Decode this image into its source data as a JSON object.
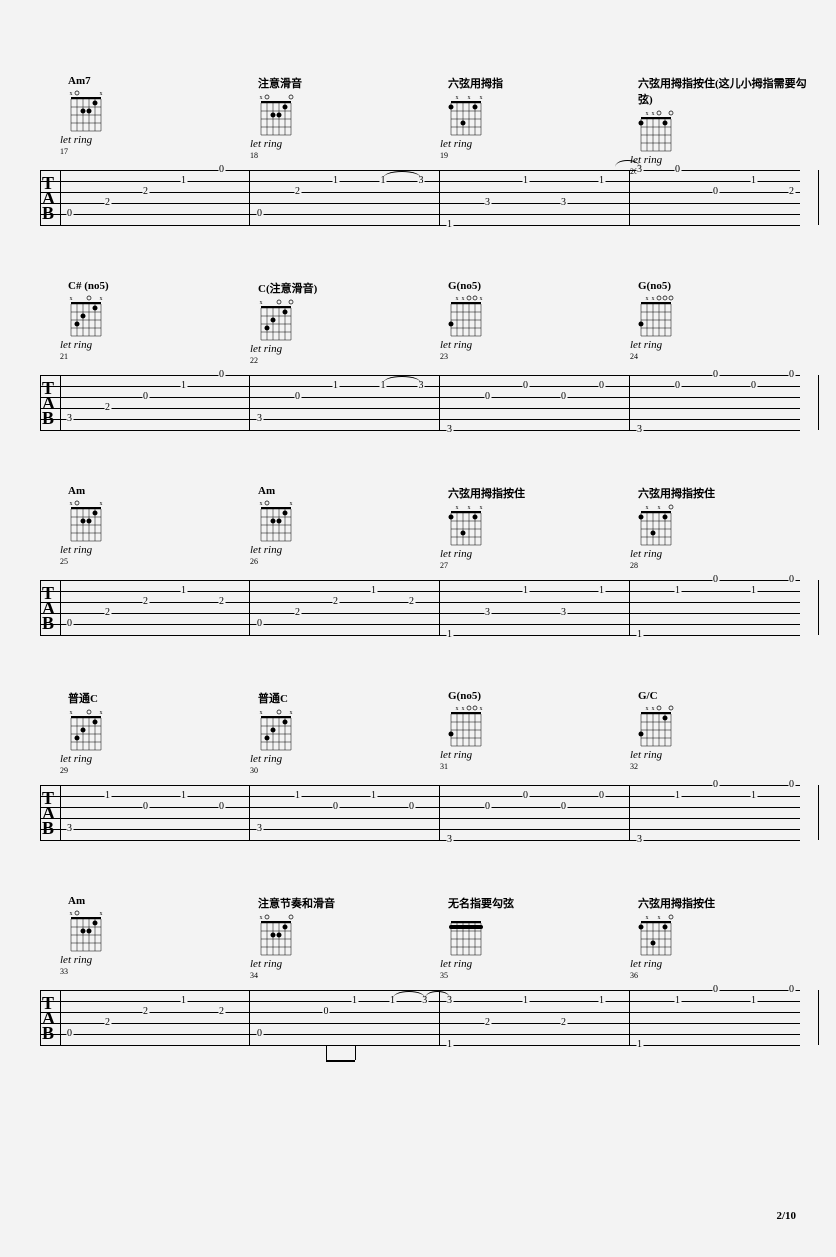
{
  "page_number": "2/10",
  "systems": [
    {
      "measures": [
        {
          "num": "17",
          "chord": "Am7",
          "letring": "let ring",
          "notes": [
            {
              "s": 5,
              "f": "0",
              "p": 5
            },
            {
              "s": 4,
              "f": "2",
              "p": 25
            },
            {
              "s": 3,
              "f": "2",
              "p": 45
            },
            {
              "s": 2,
              "f": "1",
              "p": 65
            },
            {
              "s": 1,
              "f": "0",
              "p": 85
            }
          ],
          "dots": [
            {
              "s": 2,
              "f": 1
            },
            {
              "s": 3,
              "f": 2
            },
            {
              "s": 4,
              "f": 2
            }
          ],
          "muted": [
            1,
            6
          ],
          "open": [
            5
          ]
        },
        {
          "num": "18",
          "chord": "注意滑音",
          "letring": "let ring",
          "notes": [
            {
              "s": 5,
              "f": "0",
              "p": 5
            },
            {
              "s": 3,
              "f": "2",
              "p": 25
            },
            {
              "s": 2,
              "f": "1",
              "p": 45
            },
            {
              "s": 2,
              "f": "1",
              "p": 70
            },
            {
              "s": 2,
              "f": "3",
              "p": 90,
              "tie_from": 70
            }
          ],
          "dots": [
            {
              "s": 2,
              "f": 1
            },
            {
              "s": 3,
              "f": 2
            },
            {
              "s": 4,
              "f": 2
            }
          ],
          "muted": [
            6
          ],
          "open": [
            1,
            5
          ]
        },
        {
          "num": "19",
          "chord": "六弦用拇指",
          "letring": "let ring",
          "notes": [
            {
              "s": 6,
              "f": "1",
              "p": 5
            },
            {
              "s": 4,
              "f": "3",
              "p": 25
            },
            {
              "s": 2,
              "f": "1",
              "p": 45
            },
            {
              "s": 4,
              "f": "3",
              "p": 65
            },
            {
              "s": 2,
              "f": "1",
              "p": 85
            }
          ],
          "dots": [
            {
              "s": 2,
              "f": 1
            },
            {
              "s": 4,
              "f": 3
            },
            {
              "s": 6,
              "f": 1
            }
          ],
          "muted": [
            1,
            3,
            5
          ]
        },
        {
          "num": "20",
          "chord": "六弦用拇指按住(这儿小拇指需要勾弦)",
          "letring": "let ring",
          "notes": [
            {
              "s": 1,
              "f": "3",
              "p": 5,
              "tie_to": true
            },
            {
              "s": 1,
              "f": "0",
              "p": 25
            },
            {
              "s": 3,
              "f": "0",
              "p": 45
            },
            {
              "s": 2,
              "f": "1",
              "p": 65
            },
            {
              "s": 3,
              "f": "2",
              "p": 85
            }
          ],
          "dots": [
            {
              "s": 2,
              "f": 1
            },
            {
              "s": 6,
              "f": 1
            }
          ],
          "muted": [
            4,
            5
          ],
          "open": [
            1,
            3
          ]
        }
      ]
    },
    {
      "measures": [
        {
          "num": "21",
          "chord": "C# (no5)",
          "letring": "let ring",
          "notes": [
            {
              "s": 5,
              "f": "3",
              "p": 5
            },
            {
              "s": 4,
              "f": "2",
              "p": 25
            },
            {
              "s": 3,
              "f": "0",
              "p": 45
            },
            {
              "s": 2,
              "f": "1",
              "p": 65
            },
            {
              "s": 1,
              "f": "0",
              "p": 85
            }
          ],
          "dots": [
            {
              "s": 2,
              "f": 1
            },
            {
              "s": 4,
              "f": 2
            },
            {
              "s": 5,
              "f": 3
            }
          ],
          "muted": [
            1,
            6
          ],
          "open": [
            3
          ]
        },
        {
          "num": "22",
          "chord": "C(注意滑音)",
          "letring": "let ring",
          "notes": [
            {
              "s": 5,
              "f": "3",
              "p": 5
            },
            {
              "s": 3,
              "f": "0",
              "p": 25
            },
            {
              "s": 2,
              "f": "1",
              "p": 45
            },
            {
              "s": 2,
              "f": "1",
              "p": 70
            },
            {
              "s": 2,
              "f": "3",
              "p": 90,
              "tie_from": 70
            }
          ],
          "dots": [
            {
              "s": 2,
              "f": 1
            },
            {
              "s": 4,
              "f": 2
            },
            {
              "s": 5,
              "f": 3
            }
          ],
          "muted": [
            6
          ],
          "open": [
            1,
            3
          ]
        },
        {
          "num": "23",
          "chord": "G(no5)",
          "letring": "let ring",
          "notes": [
            {
              "s": 6,
              "f": "3",
              "p": 5
            },
            {
              "s": 3,
              "f": "0",
              "p": 25
            },
            {
              "s": 2,
              "f": "0",
              "p": 45
            },
            {
              "s": 3,
              "f": "0",
              "p": 65
            },
            {
              "s": 2,
              "f": "0",
              "p": 85
            }
          ],
          "dots": [
            {
              "s": 6,
              "f": 3
            }
          ],
          "muted": [
            1,
            4,
            5
          ],
          "open": [
            2,
            3
          ]
        },
        {
          "num": "24",
          "chord": "G(no5)",
          "letring": "let ring",
          "notes": [
            {
              "s": 6,
              "f": "3",
              "p": 5
            },
            {
              "s": 2,
              "f": "0",
              "p": 25
            },
            {
              "s": 1,
              "f": "0",
              "p": 45
            },
            {
              "s": 2,
              "f": "0",
              "p": 65
            },
            {
              "s": 1,
              "f": "0",
              "p": 85
            }
          ],
          "dots": [
            {
              "s": 6,
              "f": 3
            }
          ],
          "muted": [
            4,
            5
          ],
          "open": [
            1,
            2,
            3
          ]
        }
      ]
    },
    {
      "measures": [
        {
          "num": "25",
          "chord": "Am",
          "letring": "let ring",
          "notes": [
            {
              "s": 5,
              "f": "0",
              "p": 5
            },
            {
              "s": 4,
              "f": "2",
              "p": 25
            },
            {
              "s": 3,
              "f": "2",
              "p": 45
            },
            {
              "s": 2,
              "f": "1",
              "p": 65
            },
            {
              "s": 3,
              "f": "2",
              "p": 85
            }
          ],
          "dots": [
            {
              "s": 2,
              "f": 1
            },
            {
              "s": 3,
              "f": 2
            },
            {
              "s": 4,
              "f": 2
            }
          ],
          "muted": [
            1,
            6
          ],
          "open": [
            5
          ]
        },
        {
          "num": "26",
          "chord": "Am",
          "letring": "let ring",
          "notes": [
            {
              "s": 5,
              "f": "0",
              "p": 5
            },
            {
              "s": 4,
              "f": "2",
              "p": 25
            },
            {
              "s": 3,
              "f": "2",
              "p": 45
            },
            {
              "s": 2,
              "f": "1",
              "p": 65
            },
            {
              "s": 3,
              "f": "2",
              "p": 85
            }
          ],
          "dots": [
            {
              "s": 2,
              "f": 1
            },
            {
              "s": 3,
              "f": 2
            },
            {
              "s": 4,
              "f": 2
            }
          ],
          "muted": [
            1,
            6
          ],
          "open": [
            5
          ]
        },
        {
          "num": "27",
          "chord": "六弦用拇指按住",
          "letring": "let ring",
          "notes": [
            {
              "s": 6,
              "f": "1",
              "p": 5
            },
            {
              "s": 4,
              "f": "3",
              "p": 25
            },
            {
              "s": 2,
              "f": "1",
              "p": 45
            },
            {
              "s": 4,
              "f": "3",
              "p": 65
            },
            {
              "s": 2,
              "f": "1",
              "p": 85
            }
          ],
          "dots": [
            {
              "s": 2,
              "f": 1
            },
            {
              "s": 4,
              "f": 3
            },
            {
              "s": 6,
              "f": 1
            }
          ],
          "muted": [
            1,
            3,
            5
          ]
        },
        {
          "num": "28",
          "chord": "六弦用拇指按住",
          "letring": "let ring",
          "notes": [
            {
              "s": 6,
              "f": "1",
              "p": 5
            },
            {
              "s": 2,
              "f": "1",
              "p": 25
            },
            {
              "s": 1,
              "f": "0",
              "p": 45
            },
            {
              "s": 2,
              "f": "1",
              "p": 65
            },
            {
              "s": 1,
              "f": "0",
              "p": 85
            }
          ],
          "dots": [
            {
              "s": 2,
              "f": 1
            },
            {
              "s": 4,
              "f": 3
            },
            {
              "s": 6,
              "f": 1
            }
          ],
          "muted": [
            3,
            5
          ],
          "open": [
            1
          ]
        }
      ]
    },
    {
      "measures": [
        {
          "num": "29",
          "chord": "普通C",
          "letring": "let ring",
          "notes": [
            {
              "s": 5,
              "f": "3",
              "p": 5
            },
            {
              "s": 2,
              "f": "1",
              "p": 25
            },
            {
              "s": 3,
              "f": "0",
              "p": 45
            },
            {
              "s": 2,
              "f": "1",
              "p": 65
            },
            {
              "s": 3,
              "f": "0",
              "p": 85
            }
          ],
          "dots": [
            {
              "s": 2,
              "f": 1
            },
            {
              "s": 4,
              "f": 2
            },
            {
              "s": 5,
              "f": 3
            }
          ],
          "muted": [
            1,
            6
          ],
          "open": [
            3
          ]
        },
        {
          "num": "30",
          "chord": "普通C",
          "letring": "let ring",
          "notes": [
            {
              "s": 5,
              "f": "3",
              "p": 5
            },
            {
              "s": 2,
              "f": "1",
              "p": 25
            },
            {
              "s": 3,
              "f": "0",
              "p": 45
            },
            {
              "s": 2,
              "f": "1",
              "p": 65
            },
            {
              "s": 3,
              "f": "0",
              "p": 85
            }
          ],
          "dots": [
            {
              "s": 2,
              "f": 1
            },
            {
              "s": 4,
              "f": 2
            },
            {
              "s": 5,
              "f": 3
            }
          ],
          "muted": [
            1,
            6
          ],
          "open": [
            3
          ]
        },
        {
          "num": "31",
          "chord": "G(no5)",
          "letring": "let ring",
          "notes": [
            {
              "s": 6,
              "f": "3",
              "p": 5
            },
            {
              "s": 3,
              "f": "0",
              "p": 25
            },
            {
              "s": 2,
              "f": "0",
              "p": 45
            },
            {
              "s": 3,
              "f": "0",
              "p": 65
            },
            {
              "s": 2,
              "f": "0",
              "p": 85
            }
          ],
          "dots": [
            {
              "s": 6,
              "f": 3
            }
          ],
          "muted": [
            1,
            4,
            5
          ],
          "open": [
            2,
            3
          ]
        },
        {
          "num": "32",
          "chord": "G/C",
          "letring": "let ring",
          "notes": [
            {
              "s": 6,
              "f": "3",
              "p": 5
            },
            {
              "s": 2,
              "f": "1",
              "p": 25
            },
            {
              "s": 1,
              "f": "0",
              "p": 45
            },
            {
              "s": 2,
              "f": "1",
              "p": 65
            },
            {
              "s": 1,
              "f": "0",
              "p": 85
            }
          ],
          "dots": [
            {
              "s": 2,
              "f": 1
            },
            {
              "s": 6,
              "f": 3
            }
          ],
          "muted": [
            4,
            5
          ],
          "open": [
            1,
            3
          ]
        }
      ]
    },
    {
      "measures": [
        {
          "num": "33",
          "chord": "Am",
          "letring": "let ring",
          "notes": [
            {
              "s": 5,
              "f": "0",
              "p": 5
            },
            {
              "s": 4,
              "f": "2",
              "p": 25
            },
            {
              "s": 3,
              "f": "2",
              "p": 45
            },
            {
              "s": 2,
              "f": "1",
              "p": 65
            },
            {
              "s": 3,
              "f": "2",
              "p": 85
            }
          ],
          "dots": [
            {
              "s": 2,
              "f": 1
            },
            {
              "s": 3,
              "f": 2
            },
            {
              "s": 4,
              "f": 2
            }
          ],
          "muted": [
            1,
            6
          ],
          "open": [
            5
          ]
        },
        {
          "num": "34",
          "chord": "注意节奏和滑音",
          "letring": "let ring",
          "notes": [
            {
              "s": 5,
              "f": "0",
              "p": 5
            },
            {
              "s": 3,
              "f": "0",
              "p": 40
            },
            {
              "s": 2,
              "f": "1",
              "p": 55
            },
            {
              "s": 2,
              "f": "1",
              "p": 75
            },
            {
              "s": 2,
              "f": "3",
              "p": 92,
              "tie_from": 75
            }
          ],
          "dots": [
            {
              "s": 2,
              "f": 1
            },
            {
              "s": 3,
              "f": 2
            },
            {
              "s": 4,
              "f": 2
            }
          ],
          "muted": [
            6
          ],
          "open": [
            1,
            5
          ],
          "beam": [
            {
              "from": 40,
              "to": 55,
              "y": 70
            }
          ]
        },
        {
          "num": "35",
          "chord": "无名指要勾弦",
          "letring": "let ring",
          "notes": [
            {
              "s": 2,
              "f": "3",
              "p": 5,
              "tie_to": true
            },
            {
              "s": 6,
              "f": "1",
              "p": 5
            },
            {
              "s": 4,
              "f": "2",
              "p": 25
            },
            {
              "s": 2,
              "f": "1",
              "p": 45
            },
            {
              "s": 4,
              "f": "2",
              "p": 65
            },
            {
              "s": 2,
              "f": "1",
              "p": 85
            }
          ],
          "dots": [],
          "barre": 1,
          "muted": []
        },
        {
          "num": "36",
          "chord": "六弦用拇指按住",
          "letring": "let ring",
          "notes": [
            {
              "s": 6,
              "f": "1",
              "p": 5
            },
            {
              "s": 2,
              "f": "1",
              "p": 25
            },
            {
              "s": 1,
              "f": "0",
              "p": 45
            },
            {
              "s": 2,
              "f": "1",
              "p": 65
            },
            {
              "s": 1,
              "f": "0",
              "p": 85
            }
          ],
          "dots": [
            {
              "s": 2,
              "f": 1
            },
            {
              "s": 4,
              "f": 3
            },
            {
              "s": 6,
              "f": 1
            }
          ],
          "muted": [
            3,
            5
          ],
          "open": [
            1
          ]
        }
      ]
    }
  ]
}
